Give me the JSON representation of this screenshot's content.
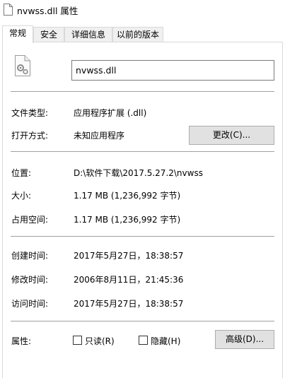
{
  "window": {
    "title": "nvwss.dll 属性"
  },
  "tabs": [
    {
      "label": "常规"
    },
    {
      "label": "安全"
    },
    {
      "label": "详细信息"
    },
    {
      "label": "以前的版本"
    }
  ],
  "general": {
    "file_name": "nvwss.dll",
    "file_type_label": "文件类型:",
    "file_type_value": "应用程序扩展 (.dll)",
    "opens_with_label": "打开方式:",
    "opens_with_value": "未知应用程序",
    "change_button": "更改(C)...",
    "location_label": "位置:",
    "location_value": "D:\\软件下载\\2017.5.27.2\\nvwss",
    "size_label": "大小:",
    "size_value": "1.17 MB (1,236,992 字节)",
    "size_on_disk_label": "占用空间:",
    "size_on_disk_value": "1.17 MB (1,236,992 字节)",
    "created_label": "创建时间:",
    "created_value": "2017年5月27日，18:38:57",
    "modified_label": "修改时间:",
    "modified_value": "2006年8月11日，21:45:36",
    "accessed_label": "访问时间:",
    "accessed_value": "2017年5月27日，18:38:57",
    "attributes_label": "属性:",
    "readonly_label": "只读(R)",
    "hidden_label": "隐藏(H)",
    "advanced_button": "高级(D)..."
  },
  "icons": {
    "title_icon": "document-icon",
    "file_icon": "dll-file-icon"
  }
}
